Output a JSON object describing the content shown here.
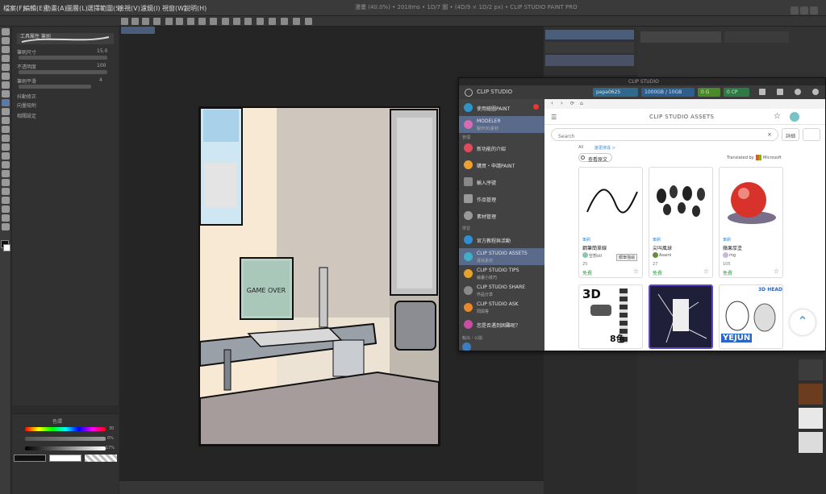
{
  "window": {
    "title": "漫畫 (40.0%) • 2018ms • 1D/7 圖 • (4D/9 × 1D/2 px) • CLIP STUDIO PAINT PRO"
  },
  "menu": [
    "檔案(F)",
    "編輯(E)",
    "動畫(A)",
    "圖層(L)",
    "選擇範圍(S)",
    "檢視(V)",
    "濾鏡(I)",
    "視窗(W)",
    "說明(H)"
  ],
  "tool_property": {
    "brush_name": "工具屬性 筆刷",
    "size_label": "筆刷尺寸",
    "size_value": "15.0",
    "opacity_label": "不透明度",
    "opacity_value": "100",
    "stabilize_label": "筆刷平滑",
    "stabilize_value": "4",
    "correction_label": "抖動修正",
    "vector_label": "向量吸附",
    "setting_label": "相關設定"
  },
  "color_panel": {
    "tab_label": "色環",
    "h_value": "30",
    "s_value": "0%",
    "v_value": "17%"
  },
  "artwork": {
    "monitor_text": "GAME OVER"
  },
  "clip_studio": {
    "window_title": "CLIP STUDIO",
    "app_name": "CLIP STUDIO",
    "user_name": "papa0625",
    "storage": "1000GB / 10GB",
    "gold_label": "0 G",
    "clippy_label": "0 CP",
    "sidebar": {
      "paint_label": "使用繪圖PAINT",
      "modeler_label": "MODELER",
      "modeler_sub": "製作3D素材",
      "section_manage": "管理",
      "new_features": "新功能的介紹",
      "purchase": "購買・申請PAINT",
      "input_serial": "輸入序號",
      "works": "作品管理",
      "materials": "素材管理",
      "section_learn": "學習",
      "official": "官方教程與活動",
      "assets_label": "CLIP STUDIO ASSETS",
      "assets_sub": "尋找素材",
      "tips_label": "CLIP STUDIO TIPS",
      "tips_sub": "繪畫小技巧",
      "share_label": "CLIP STUDIO SHARE",
      "share_sub": "作品分享",
      "ask_label": "CLIP STUDIO ASK",
      "ask_sub": "問與答",
      "help_label": "您是否遇到困難呢？",
      "section_bottom": "輸出・公開"
    },
    "assets": {
      "title": "CLIP STUDIO ASSETS",
      "search_placeholder": "Search",
      "detail_button": "詳細",
      "nav_all": "All",
      "nav_more": "變更搜尋 >",
      "view_original": "查看原文",
      "translated_by": "Translated by",
      "microsoft": "Microsoft",
      "cards": [
        {
          "category": "筆刷",
          "name": "鋼筆簡單線",
          "author": "空想stl",
          "downloads": "25",
          "price": "免費",
          "tooltip": "鋼筆描繪"
        },
        {
          "category": "筆刷",
          "name": "尖叫風球",
          "author": "Asami",
          "downloads": "27",
          "price": "免費"
        },
        {
          "category": "筆刷",
          "name": "蘋果厚塗",
          "author": "mg",
          "downloads": "105",
          "price": "免費"
        }
      ],
      "row2_texts": [
        "3D",
        "8色",
        "3D HEAD",
        "YEJUN"
      ]
    }
  }
}
